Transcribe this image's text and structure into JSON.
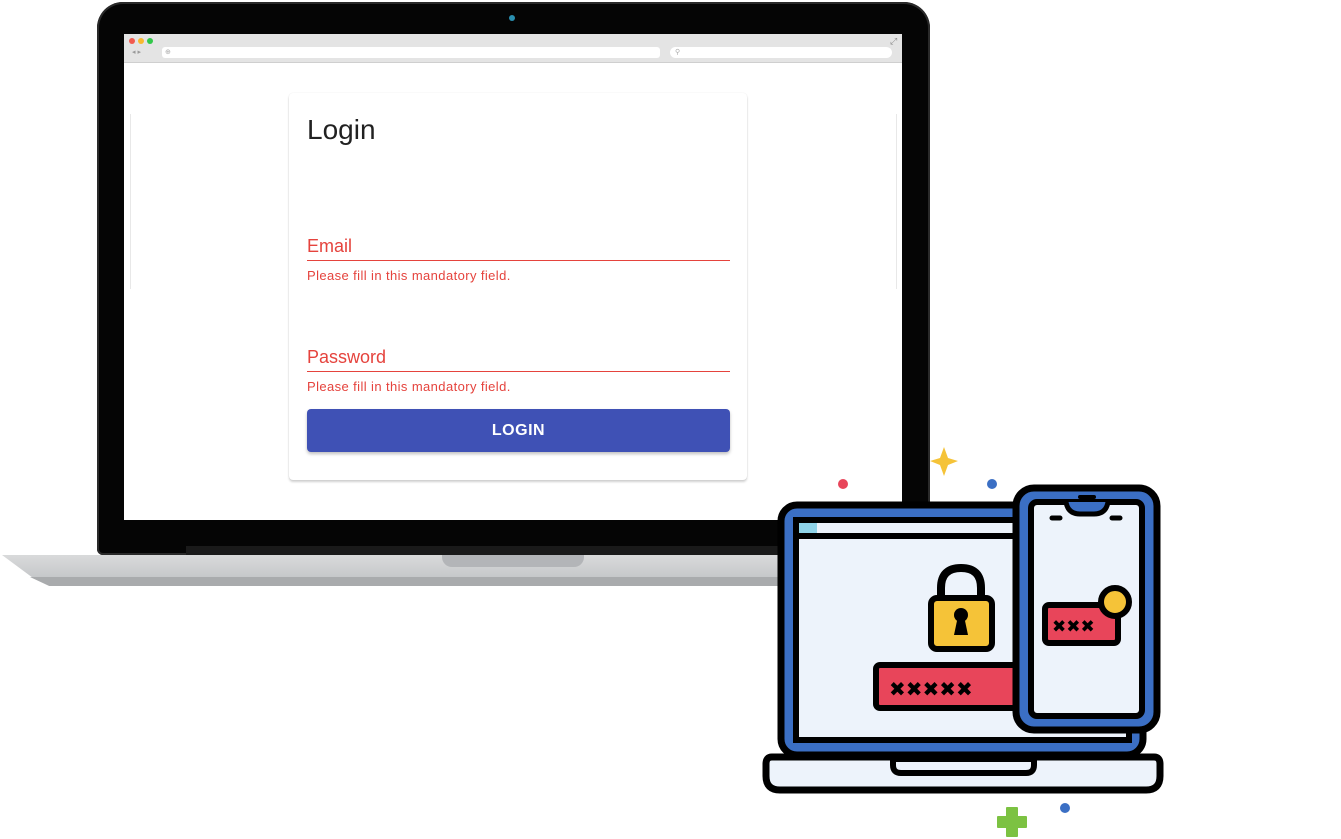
{
  "browser": {
    "nav_arrows": "◂ ▸",
    "url_glyph": "⊕",
    "search_glyph": "⚲",
    "expand_glyph": "⤢"
  },
  "login": {
    "title": "Login",
    "email_placeholder": "Email",
    "email_error": "Please fill in this mandatory field.",
    "password_placeholder": "Password",
    "password_error": "Please fill in this mandatory field.",
    "button_label": "LOGIN"
  },
  "illustration": {
    "laptop_password_mask": "✖✖✖✖✖",
    "phone_password_mask": "✖✖✖"
  },
  "colors": {
    "error": "#e5433d",
    "primary": "#3f51b5",
    "illustration_blue": "#3b6fc4",
    "illustration_red": "#e8455a",
    "illustration_yellow": "#f5c338",
    "illustration_bg": "#edf3fb"
  }
}
